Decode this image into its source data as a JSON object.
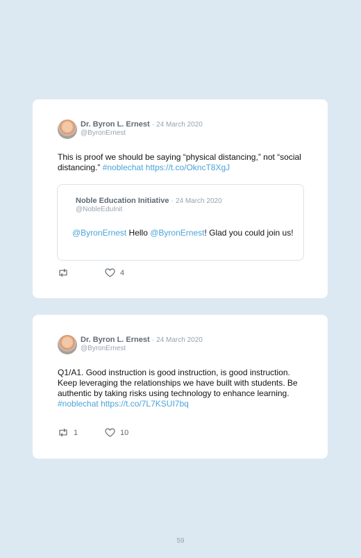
{
  "tweets": [
    {
      "author": "Dr. Byron L. Ernest",
      "separator": "·",
      "date": "24 March 2020",
      "handle": "@ByronErnest",
      "text_prefix": "This is proof we should be saying “physical distancing,” not “social distancing.” ",
      "hashtag": "#noblechat",
      "url": "https://t.co/OkncT8XgJ",
      "quoted": {
        "author": "Noble Education Initiative",
        "separator": "·",
        "date": "24 March 2020",
        "handle": "@NobleEduInit",
        "mention1": "@ByronErnest",
        "mid_text": " Hello ",
        "mention2": "@ByronErnest",
        "end_text": "! Glad you could join us!"
      },
      "retweet_count": "",
      "like_count": "4"
    },
    {
      "author": "Dr. Byron L. Ernest",
      "separator": "·",
      "date": "24 March 2020",
      "handle": "@ByronErnest",
      "text_prefix": "Q1/A1. Good instruction is good instruction, is good instruction. Keep leveraging the relationships we have built with students. Be authentic by taking risks using technology to enhance learning. ",
      "hashtag": "#noblechat",
      "url": "https://t.co/7L7KSUI7bq",
      "retweet_count": "1",
      "like_count": "10"
    }
  ],
  "page_number": "59",
  "icons": {
    "retweet": "retweet-icon",
    "like": "heart-icon"
  },
  "colors": {
    "background": "#dde9f2",
    "link": "#4aa3d8",
    "card": "#ffffff"
  }
}
